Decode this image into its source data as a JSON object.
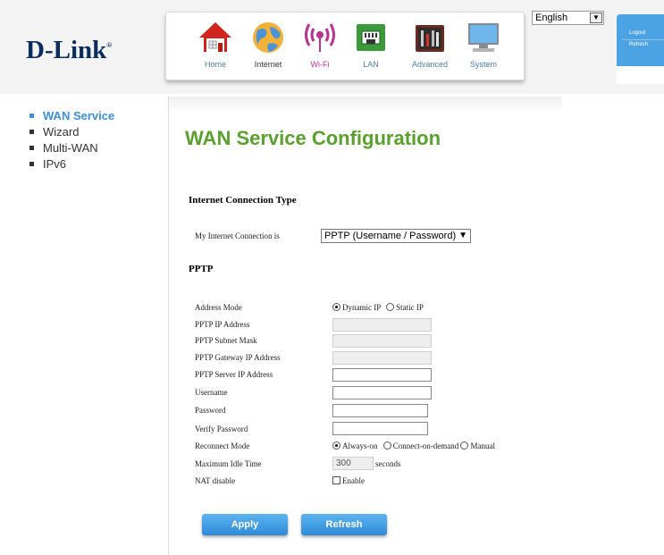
{
  "brand": {
    "logo_text": "D-Link",
    "trademark": "®"
  },
  "nav": {
    "items": [
      {
        "label": "Home",
        "icon": "home-icon"
      },
      {
        "label": "Internet",
        "icon": "globe-icon"
      },
      {
        "label": "Wi-Fi",
        "icon": "wifi-icon"
      },
      {
        "label": "LAN",
        "icon": "lan-icon"
      },
      {
        "label": "Advanced",
        "icon": "toolbox-icon"
      },
      {
        "label": "System",
        "icon": "computer-icon"
      }
    ],
    "active": "Internet"
  },
  "language": {
    "selected": "English"
  },
  "corner": {
    "logout": "Logout",
    "refresh": "Refresh"
  },
  "sidebar": {
    "items": [
      {
        "label": "WAN Service",
        "active": true
      },
      {
        "label": "Wizard"
      },
      {
        "label": "Multi-WAN"
      },
      {
        "label": "IPv6"
      }
    ]
  },
  "main": {
    "title": "WAN Service Configuration",
    "connection_section": "Internet Connection Type",
    "connection_label": "My Internet Connection is",
    "connection_value": "PPTP (Username / Password)",
    "pptp_section": "PPTP",
    "fields": {
      "address_mode": "Address Mode",
      "pptp_ip": "PPTP IP Address",
      "pptp_subnet": "PPTP Subnet Mask",
      "pptp_gateway": "PPTP Gateway IP Address",
      "pptp_server": "PPTP Server IP Address",
      "username": "Username",
      "password": "Password",
      "verify_password": "Verify Password",
      "reconnect_mode": "Reconnect Mode",
      "max_idle": "Maximum Idle Time",
      "nat_disable": "NAT disable"
    },
    "address_mode_options": {
      "dynamic": "Dynamic IP",
      "static": "Static IP",
      "selected": "Dynamic IP"
    },
    "reconnect_options": {
      "always": "Always-on",
      "demand": "Connect-on-demand",
      "manual": "Manual",
      "selected": "Always-on"
    },
    "max_idle_value": "300",
    "max_idle_unit": "seconds",
    "nat_enable_label": "Enable",
    "apply_label": "Apply",
    "refresh_label": "Refresh"
  },
  "colors": {
    "title_green": "#5aa02c",
    "accent_blue": "#3c8fd6",
    "button_blue": "#2f8ad8"
  }
}
